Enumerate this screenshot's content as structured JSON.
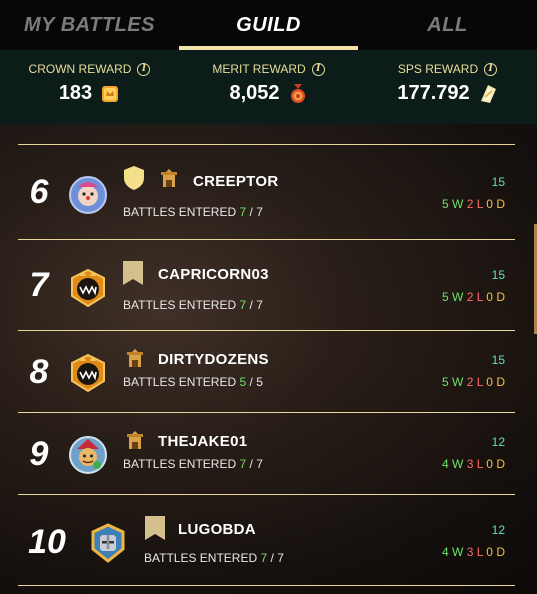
{
  "tabs": [
    {
      "label": "MY BATTLES",
      "active": false
    },
    {
      "label": "GUILD",
      "active": true
    },
    {
      "label": "ALL",
      "active": false
    }
  ],
  "rewards": [
    {
      "label": "CROWN REWARD",
      "value": "183",
      "icon": "crown-reward-icon"
    },
    {
      "label": "MERIT REWARD",
      "value": "8,052",
      "icon": "merit-medal-icon"
    },
    {
      "label": "SPS REWARD",
      "value": "177.792",
      "icon": "sps-token-icon"
    }
  ],
  "players": [
    {
      "rank": "6",
      "name": "CREEPTOR",
      "battles_label": "BATTLES ENTERED",
      "entered": "7",
      "total": "7",
      "score": "15",
      "wins": "5",
      "losses": "2",
      "draws": "0",
      "avatar": "clown-avatar",
      "badges": [
        "gold-shield-icon",
        "guild-tower-icon"
      ]
    },
    {
      "rank": "7",
      "name": "CAPRICORN03",
      "battles_label": "BATTLES ENTERED",
      "entered": "7",
      "total": "7",
      "score": "15",
      "wins": "5",
      "losses": "2",
      "draws": "0",
      "avatar": "monster-avatar",
      "badges": [
        "banner-icon"
      ]
    },
    {
      "rank": "8",
      "name": "DIRTYDOZENS",
      "battles_label": "BATTLES ENTERED",
      "entered": "5",
      "total": "5",
      "score": "15",
      "wins": "5",
      "losses": "2",
      "draws": "0",
      "avatar": "monster-avatar",
      "badges": [
        "guild-tower-icon"
      ]
    },
    {
      "rank": "9",
      "name": "THEJAKE01",
      "battles_label": "BATTLES ENTERED",
      "entered": "7",
      "total": "7",
      "score": "12",
      "wins": "4",
      "losses": "3",
      "draws": "0",
      "avatar": "jester-avatar",
      "badges": [
        "guild-tower-icon"
      ]
    },
    {
      "rank": "10",
      "name": "LUGOBDA",
      "battles_label": "BATTLES ENTERED",
      "entered": "7",
      "total": "7",
      "score": "12",
      "wins": "4",
      "losses": "3",
      "draws": "0",
      "avatar": "knight-avatar",
      "badges": [
        "banner-icon"
      ]
    }
  ],
  "record_letters": {
    "w": "W",
    "l": "L",
    "d": "D"
  },
  "colors": {
    "tab_underline": "#f3e3a6",
    "reward_bar": "#0b1c19",
    "win": "#6fe06a",
    "loss": "#ff6a6a",
    "draw": "#f3c04a",
    "score": "#5fe0c8",
    "divider": "#e7d79a"
  }
}
